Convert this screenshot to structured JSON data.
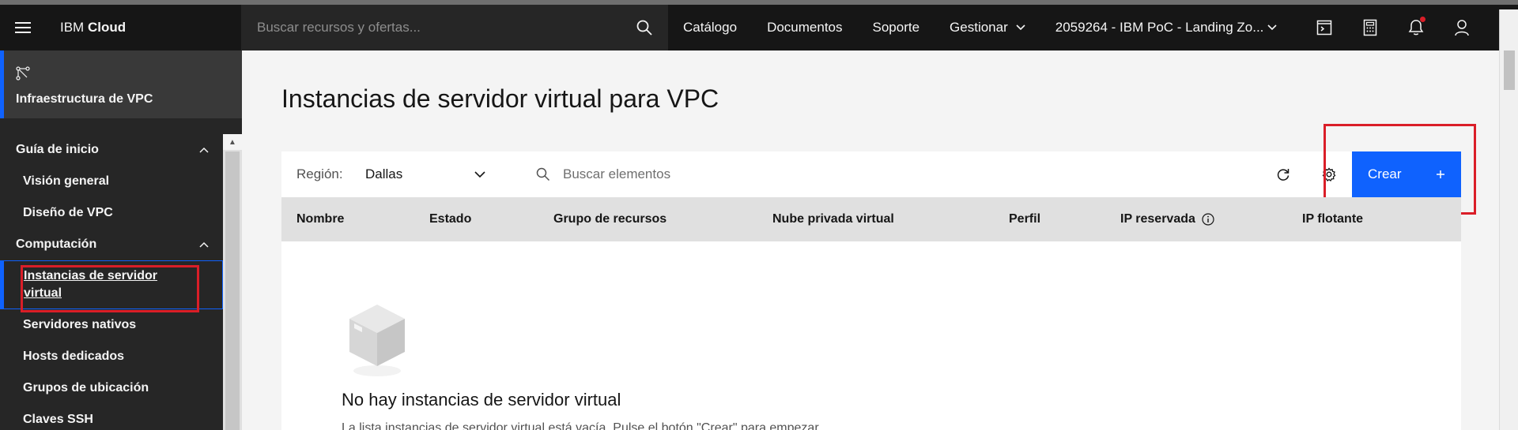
{
  "topbar": {
    "brand_light": "IBM",
    "brand_bold": "Cloud",
    "search_placeholder": "Buscar recursos y ofertas...",
    "nav": {
      "catalog": "Catálogo",
      "docs": "Documentos",
      "support": "Soporte",
      "manage": "Gestionar"
    },
    "account": "2059264 - IBM PoC - Landing Zo..."
  },
  "sidebar": {
    "title": "Infraestructura de VPC",
    "groups": [
      {
        "label": "Guía de inicio",
        "items": [
          "Visión general",
          "Diseño de VPC"
        ]
      },
      {
        "label": "Computación",
        "items": [
          "Instancias de servidor virtual",
          "Servidores nativos",
          "Hosts dedicados",
          "Grupos de ubicación",
          "Claves SSH"
        ]
      }
    ]
  },
  "main": {
    "title": "Instancias de servidor virtual para VPC",
    "toolbar": {
      "region_label": "Región:",
      "region_value": "Dallas",
      "search_placeholder": "Buscar elementos",
      "create_label": "Crear"
    },
    "columns": [
      "Nombre",
      "Estado",
      "Grupo de recursos",
      "Nube privada virtual",
      "Perfil",
      "IP reservada",
      "IP flotante"
    ],
    "empty": {
      "title": "No hay instancias de servidor virtual",
      "description": "La lista instancias de servidor virtual está vacía. Pulse el botón \"Crear\" para empezar."
    }
  },
  "colors": {
    "accent": "#0f62fe",
    "highlight": "#da1e28",
    "topbar": "#161616",
    "sidebar": "#262626"
  }
}
